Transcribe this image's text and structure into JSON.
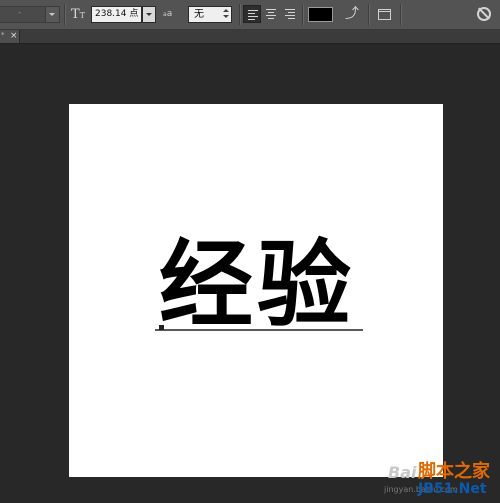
{
  "toolbar": {
    "font_style_value": "-",
    "font_size_value": "238.14 点",
    "antialias_label": "a",
    "antialias_small": "a",
    "antialias_value": "无",
    "text_color": "#000000",
    "icons": [
      "font-size-icon",
      "align-left-icon",
      "align-center-icon",
      "align-right-icon",
      "warp-text-icon",
      "panels-icon",
      "cancel-icon"
    ]
  },
  "tabs": [
    {
      "mark": "*",
      "close": "×"
    }
  ],
  "canvas": {
    "background": "#ffffff",
    "text": "经验",
    "text_color": "#000000"
  },
  "watermark": {
    "site_cn": "脚本之家",
    "url_small": "jingyan.baidu.com",
    "url_big": "JB51.Net",
    "paw": "Bai"
  }
}
